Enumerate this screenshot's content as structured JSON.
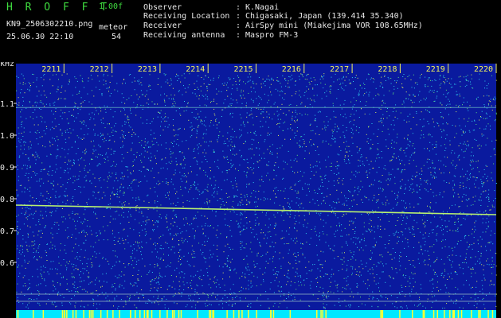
{
  "header": {
    "app_title": "H R O F F T",
    "version": "1.00f",
    "filename": "KN9_2506302210.png",
    "meteor_label": "meteor",
    "datetime": "25.06.30 22:10",
    "meteor_count": "54"
  },
  "metadata": [
    {
      "label": "Observer",
      "value": "K.Nagai"
    },
    {
      "label": "Receiving Location",
      "value": "Chigasaki, Japan (139.414 35.340)"
    },
    {
      "label": "Receiver",
      "value": "AirSpy mini (Miakejima VOR 108.65MHz)"
    },
    {
      "label": "Receiving antenna",
      "value": "Maspro FM-3"
    }
  ],
  "separator": ":",
  "spectrogram": {
    "y_unit": "kHz",
    "y_ticks": [
      {
        "label": "1.1",
        "value": 1.1
      },
      {
        "label": "1.0",
        "value": 1.0
      },
      {
        "label": "0.9",
        "value": 0.9
      },
      {
        "label": "0.8",
        "value": 0.8
      },
      {
        "label": "0.7",
        "value": 0.7
      },
      {
        "label": "0.6",
        "value": 0.6
      }
    ],
    "time_ticks": [
      "2211",
      "2212",
      "2213",
      "2214",
      "2215",
      "2216",
      "2217",
      "2218",
      "2219",
      "2220"
    ],
    "carrier_trace_khz": {
      "start": 0.78,
      "end": 0.75
    },
    "colors": {
      "background": "#0a1a9e",
      "noise_cyan": "#2fd0f0",
      "noise_green": "#5fe07a",
      "noise_yellow": "#e0f060",
      "carrier_line": "#b8f070",
      "detection_bar": "#00e8ff",
      "detection_marker": "#ffff30"
    }
  }
}
